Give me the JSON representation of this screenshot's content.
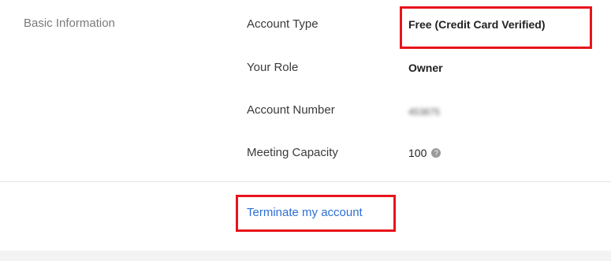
{
  "section": {
    "title": "Basic Information"
  },
  "fields": [
    {
      "label": "Account Type",
      "value": "Free (Credit Card Verified)"
    },
    {
      "label": "Your Role",
      "value": "Owner"
    },
    {
      "label": "Account Number",
      "value": "453875"
    },
    {
      "label": "Meeting Capacity",
      "value": "100"
    }
  ],
  "help_icon": {
    "glyph": "?",
    "icon": "question-circle-icon"
  },
  "actions": {
    "terminate_label": "Terminate my account"
  },
  "colors": {
    "highlight": "#e8141b",
    "link": "#2d6ed5",
    "section_label": "#7a7a7a",
    "background": "#f3f3f3"
  }
}
